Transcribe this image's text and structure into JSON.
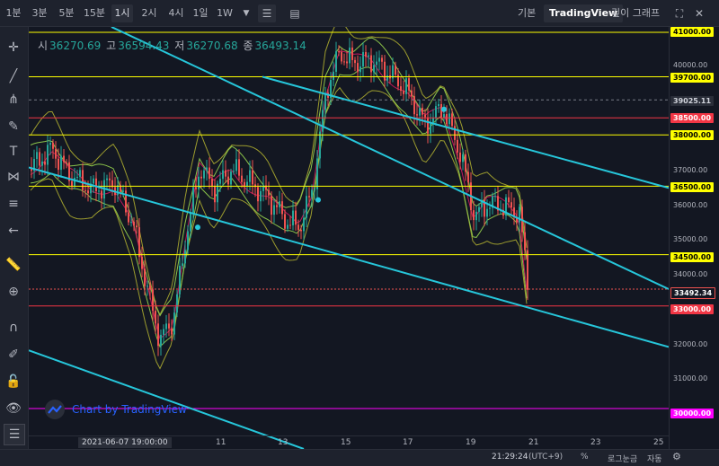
{
  "topbar": {
    "timeframes": [
      "1분",
      "3분",
      "5분",
      "15분",
      "1시",
      "2시",
      "4시",
      "1일",
      "1W"
    ],
    "active_timeframe": "1시",
    "right": {
      "basic": "기본",
      "tradingview": "TradingView",
      "depth": "깊이 그래프"
    }
  },
  "ohlc": {
    "open_label": "시",
    "open": "36270.69",
    "high_label": "고",
    "high": "36594.43",
    "low_label": "저",
    "low": "36270.68",
    "close_label": "종",
    "close": "36493.14"
  },
  "watermark": {
    "text": "Chart by TradingView"
  },
  "price_scale": {
    "labels": [
      "40000.00",
      "37000.00",
      "36000.00",
      "35000.00",
      "34000.00",
      "32000.00",
      "31000.00"
    ],
    "tags": {
      "t41000": "41000.00",
      "t39700": "39700.00",
      "t39025": "39025.11",
      "t38500": "38500.00",
      "t38000": "38000.00",
      "t36500": "36500.00",
      "t34500": "34500.00",
      "t33492": "33492.34",
      "t33000": "33000.00",
      "t30000": "30000.00"
    }
  },
  "time_scale": {
    "crosshair": "2021-06-07 19:00:00",
    "labels": [
      "11",
      "13",
      "15",
      "17",
      "19",
      "21",
      "23",
      "25"
    ]
  },
  "bottombar": {
    "time": "21:29:24",
    "tz": "(UTC+9)",
    "percent": "%",
    "log": "로그눈금",
    "auto": "자동"
  },
  "colors": {
    "bg": "#131722",
    "yellow": "#ffff00",
    "red": "#f23645",
    "magenta": "#ff00ff",
    "cyan": "#26c6da",
    "up": "#26a69a",
    "down": "#ef5350"
  }
}
